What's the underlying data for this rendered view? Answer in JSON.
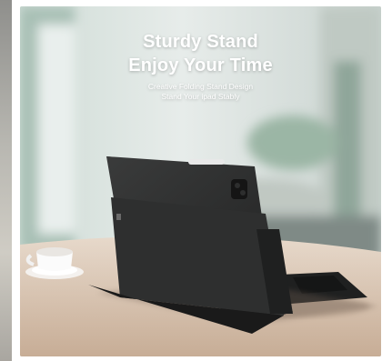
{
  "banner": {
    "headline_line1": "Sturdy Stand",
    "headline_line2": "Enjoy Your Time",
    "subline_1": "Creative Folding Stand Design",
    "subline_2": "Stand Your ipad Stably"
  },
  "colors": {
    "case": "#2b2c2c",
    "table": "#d9c7b5",
    "text": "#ffffff"
  }
}
